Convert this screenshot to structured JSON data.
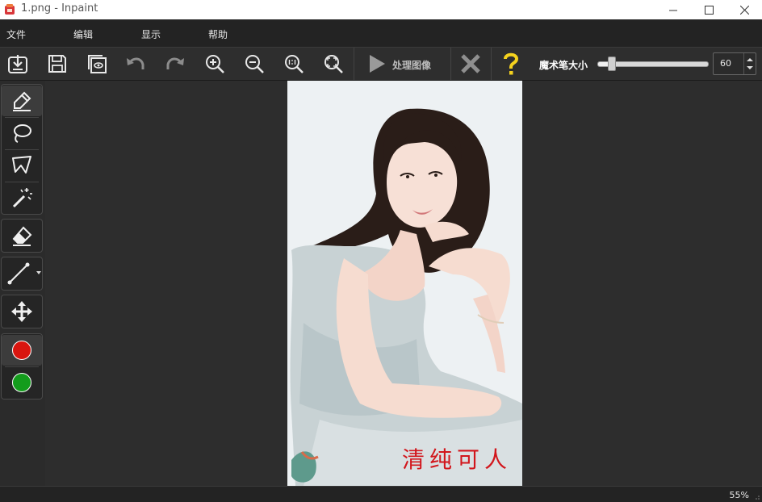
{
  "window": {
    "title": "1.png - Inpaint"
  },
  "menu": {
    "items": [
      "文件",
      "编辑",
      "显示",
      "帮助"
    ]
  },
  "toolbar": {
    "process_label": "处理图像",
    "brush_size_label": "魔术笔大小",
    "brush_size_value": "60",
    "brush_size_fraction": 0.1,
    "icons": [
      "open-icon",
      "save-icon",
      "save-as-icon",
      "undo-icon",
      "redo-icon",
      "zoom-in-icon",
      "zoom-out-icon",
      "zoom-actual-icon",
      "zoom-fit-icon",
      "play-icon",
      "cancel-x-icon",
      "help-icon"
    ]
  },
  "tools": {
    "icons": [
      "marker-icon",
      "lasso-icon",
      "polygon-lasso-icon",
      "magic-wand-icon",
      "eraser-icon",
      "line-icon",
      "move-icon"
    ],
    "color_red": "#d9150f",
    "color_green": "#139c1c"
  },
  "image": {
    "watermark_text": "清纯可人"
  },
  "status": {
    "zoom": "55%"
  },
  "colors": {
    "accent_help": "#f5d21e",
    "chrome": "#2b2b2b"
  }
}
